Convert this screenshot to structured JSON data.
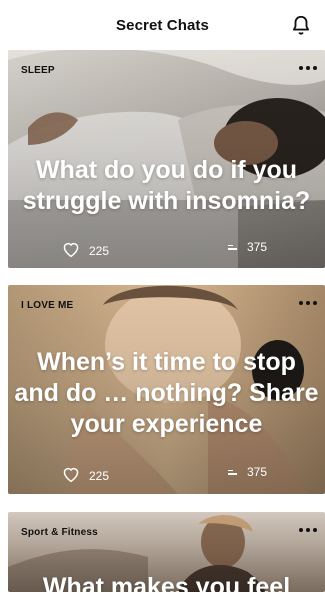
{
  "header": {
    "title": "Secret Chats",
    "bell_icon": "bell-icon"
  },
  "cards": [
    {
      "category": "SLEEP",
      "question": "What do you do if you struggle with insomnia?",
      "likes": "225",
      "comments": "375",
      "like_icon": "heart-icon",
      "comment_icon": "comment-icon",
      "more_icon": "more-icon"
    },
    {
      "category": "I LOVE ME",
      "question": "When’s it time to stop and do … nothing? Share your experience",
      "likes": "225",
      "comments": "375",
      "like_icon": "heart-icon",
      "comment_icon": "comment-icon",
      "more_icon": "more-icon"
    },
    {
      "category": "Sport & Fitness",
      "question": "What makes you feel",
      "more_icon": "more-icon"
    }
  ]
}
